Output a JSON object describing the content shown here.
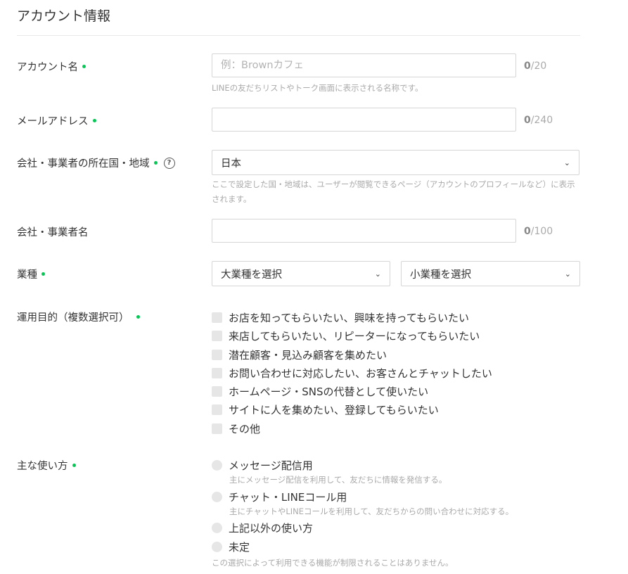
{
  "section_title": "アカウント情報",
  "colors": {
    "accent": "#06c755",
    "border": "#d6d6d6",
    "hint": "#aaaaaa"
  },
  "account_name": {
    "label": "アカウント名",
    "placeholder": "例：Brownカフェ",
    "value": "",
    "count": "0",
    "max": "/20",
    "hint": "LINEの友だちリストやトーク画面に表示される名称です。"
  },
  "email": {
    "label": "メールアドレス",
    "value": "",
    "count": "0",
    "max": "/240"
  },
  "country": {
    "label": "会社・事業者の所在国・地域",
    "help_icon": "question-circle-icon",
    "help_glyph": "?",
    "selected": "日本",
    "hint": "ここで設定した国・地域は、ユーザーが閲覧できるページ（アカウントのプロフィールなど）に表示されます。"
  },
  "company_name": {
    "label": "会社・事業者名",
    "value": "",
    "count": "0",
    "max": "/100"
  },
  "industry": {
    "label": "業種",
    "major_selected": "大業種を選択",
    "minor_selected": "小業種を選択",
    "chevron_glyph": "⌄"
  },
  "purpose": {
    "label": "運用目的（複数選択可）",
    "options": [
      "お店を知ってもらいたい、興味を持ってもらいたい",
      "来店してもらいたい、リピーターになってもらいたい",
      "潜在顧客・見込み顧客を集めたい",
      "お問い合わせに対応したい、お客さんとチャットしたい",
      "ホームページ・SNSの代替として使いたい",
      "サイトに人を集めたい、登録してもらいたい",
      "その他"
    ]
  },
  "usage": {
    "label": "主な使い方",
    "options": [
      {
        "label": "メッセージ配信用",
        "desc": "主にメッセージ配信を利用して、友だちに情報を発信する。"
      },
      {
        "label": "チャット・LINEコール用",
        "desc": "主にチャットやLINEコールを利用して、友だちからの問い合わせに対応する。"
      },
      {
        "label": "上記以外の使い方",
        "desc": ""
      },
      {
        "label": "未定",
        "desc": ""
      }
    ],
    "footnote": "この選択によって利用できる機能が制限されることはありません。"
  }
}
